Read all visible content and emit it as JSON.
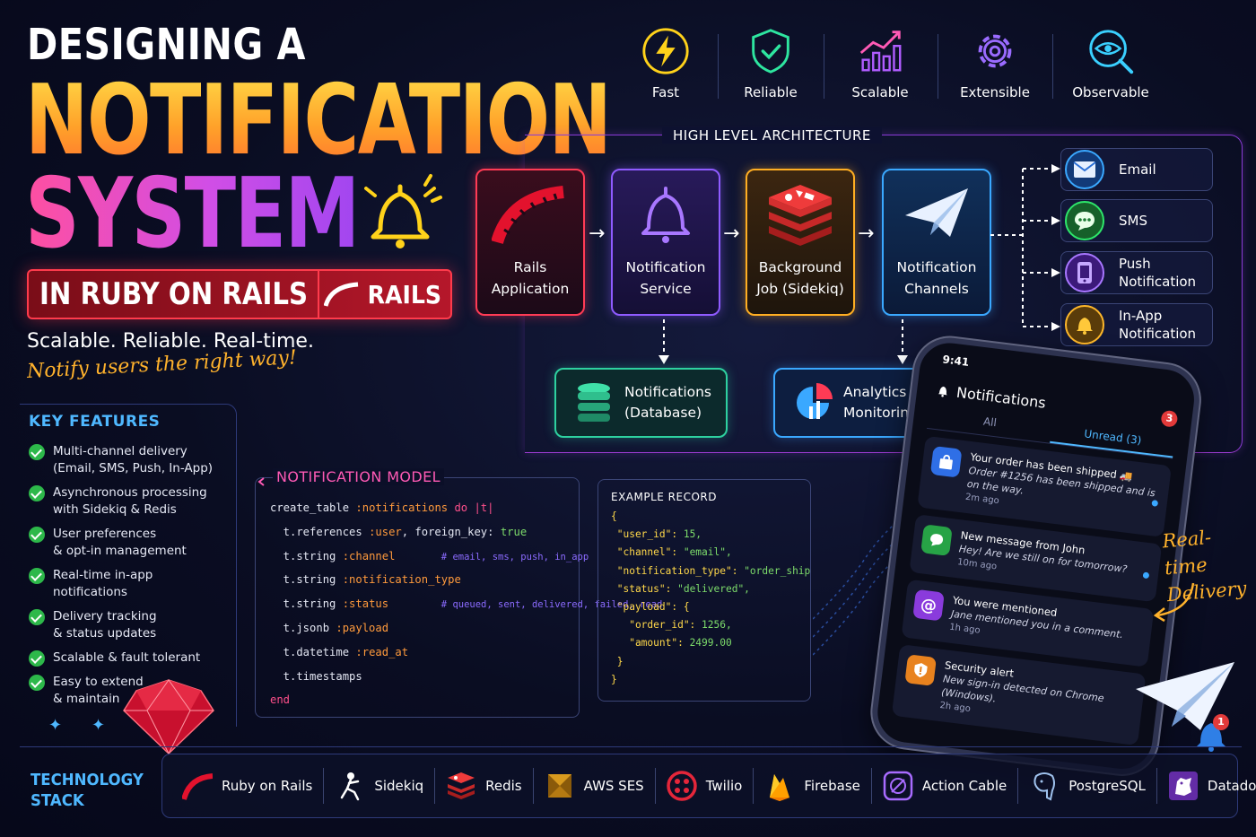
{
  "title": {
    "line1": "DESIGNING A",
    "line2": "NOTIFICATION",
    "line3": "SYSTEM",
    "banner": "IN RUBY ON RAILS",
    "banner_logo": "RAILS",
    "tagline": "Scalable. Reliable. Real-time.",
    "subtag": "Notify users the right way!"
  },
  "qualities": [
    {
      "label": "Fast",
      "icon": "lightning-icon",
      "color": "#ffd21a"
    },
    {
      "label": "Reliable",
      "icon": "shield-check-icon",
      "color": "#2ee6a0"
    },
    {
      "label": "Scalable",
      "icon": "growth-chart-icon",
      "color": "#b05cff"
    },
    {
      "label": "Extensible",
      "icon": "gear-icon",
      "color": "#9a6bff"
    },
    {
      "label": "Observable",
      "icon": "eye-search-icon",
      "color": "#3ad0ff"
    }
  ],
  "architecture": {
    "title": "HIGH LEVEL ARCHITECTURE",
    "nodes": [
      {
        "label": "Rails\nApplication",
        "icon": "rails-icon"
      },
      {
        "label": "Notification\nService",
        "icon": "bell-icon"
      },
      {
        "label": "Background\nJob (Sidekiq)",
        "icon": "redis-icon"
      },
      {
        "label": "Notification\nChannels",
        "icon": "paper-plane-icon"
      }
    ],
    "stores": [
      {
        "label": "Notifications\n(Database)",
        "icon": "database-icon"
      },
      {
        "label": "Analytics &\nMonitoring",
        "icon": "analytics-icon"
      }
    ],
    "channels": [
      {
        "label": "Email",
        "icon": "envelope-icon"
      },
      {
        "label": "SMS",
        "icon": "chat-bubble-icon"
      },
      {
        "label": "Push\nNotification",
        "icon": "phone-icon"
      },
      {
        "label": "In-App\nNotification",
        "icon": "bell-icon"
      }
    ]
  },
  "key_features": {
    "title": "KEY FEATURES",
    "items": [
      "Multi-channel delivery\n(Email, SMS, Push, In-App)",
      "Asynchronous processing\nwith Sidekiq & Redis",
      "User preferences\n& opt-in management",
      "Real-time in-app\nnotifications",
      "Delivery tracking\n& status updates",
      "Scalable & fault tolerant",
      "Easy to extend\n& maintain"
    ]
  },
  "model": {
    "title": "NOTIFICATION MODEL",
    "lines": [
      {
        "a": "create_table ",
        "b": ":notifications",
        "c": " do |t|",
        "d": ""
      },
      {
        "a": "  t.references ",
        "b": ":user",
        "c": ", foreign_key: ",
        "d": "true"
      },
      {
        "a": "  t.string ",
        "b": ":channel",
        "c": "       ",
        "d": "# email, sms, push, in_app"
      },
      {
        "a": "  t.string ",
        "b": ":notification_type",
        "c": "",
        "d": ""
      },
      {
        "a": "  t.string ",
        "b": ":status",
        "c": "        ",
        "d": "# queued, sent, delivered, failed, read"
      },
      {
        "a": "  t.jsonb ",
        "b": ":payload",
        "c": "",
        "d": ""
      },
      {
        "a": "  t.datetime ",
        "b": ":read_at",
        "c": "",
        "d": ""
      },
      {
        "a": "  t.timestamps",
        "b": "",
        "c": "",
        "d": ""
      },
      {
        "a": "end",
        "b": "",
        "c": "",
        "d": ""
      }
    ]
  },
  "example": {
    "title": "EXAMPLE RECORD",
    "lines": [
      {
        "k": "{",
        "v": ""
      },
      {
        "k": " \"user_id\": ",
        "v": "15,"
      },
      {
        "k": " \"channel\": ",
        "v": "\"email\","
      },
      {
        "k": " \"notification_type\": ",
        "v": "\"order_shipped\","
      },
      {
        "k": " \"status\": ",
        "v": "\"delivered\","
      },
      {
        "k": " \"payload\": {",
        "v": ""
      },
      {
        "k": "   \"order_id\": ",
        "v": "1256,"
      },
      {
        "k": "   \"amount\": ",
        "v": "2499.00"
      },
      {
        "k": " }",
        "v": ""
      },
      {
        "k": "}",
        "v": ""
      }
    ]
  },
  "phone": {
    "time": "9:41",
    "title": "Notifications",
    "badge": "3",
    "tab_all": "All",
    "tab_unread": "Unread (3)",
    "items": [
      {
        "title": "Your order has been shipped 🚚",
        "desc": "Order #1256 has been shipped and is on the way.",
        "time": "2m ago",
        "icon": "shopping-bag-icon",
        "color": "#2f6fe6",
        "unread": true
      },
      {
        "title": "New message from John",
        "desc": "Hey! Are we still on for tomorrow?",
        "time": "10m ago",
        "icon": "chat-bubble-icon",
        "color": "#27a346",
        "unread": true
      },
      {
        "title": "You were mentioned",
        "desc": "Jane mentioned you in a comment.",
        "time": "1h ago",
        "icon": "at-sign-icon",
        "color": "#8a3bdc",
        "unread": false
      },
      {
        "title": "Security alert",
        "desc": "New sign-in detected on Chrome (Windows).",
        "time": "2h ago",
        "icon": "shield-alert-icon",
        "color": "#e8821e",
        "unread": false
      }
    ]
  },
  "realtime_note": "Real-time\nDelivery",
  "small_bell_badge": "1",
  "tech_stack": {
    "title": "TECHNOLOGY\nSTACK",
    "items": [
      {
        "label": "Ruby on Rails",
        "icon": "rails-icon"
      },
      {
        "label": "Sidekiq",
        "icon": "sidekiq-icon"
      },
      {
        "label": "Redis",
        "icon": "redis-icon"
      },
      {
        "label": "AWS SES",
        "icon": "aws-ses-icon"
      },
      {
        "label": "Twilio",
        "icon": "twilio-icon"
      },
      {
        "label": "Firebase",
        "icon": "firebase-icon"
      },
      {
        "label": "Action Cable",
        "icon": "action-cable-icon"
      },
      {
        "label": "PostgreSQL",
        "icon": "postgresql-icon"
      },
      {
        "label": "Datadog",
        "icon": "datadog-icon"
      }
    ]
  }
}
